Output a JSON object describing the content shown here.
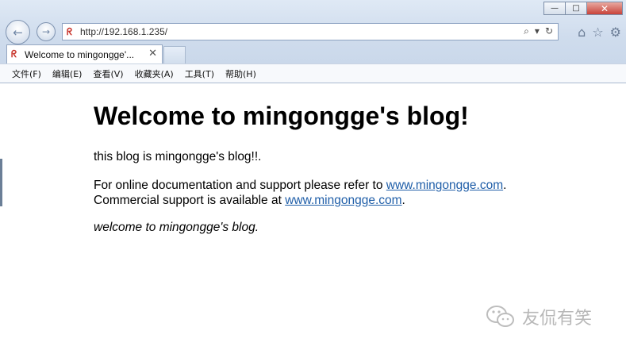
{
  "window": {
    "minimize_glyph": "—",
    "maximize_glyph": "□",
    "close_glyph": "✕"
  },
  "nav": {
    "back_glyph": "←",
    "forward_glyph": "→"
  },
  "address_bar": {
    "url": "http://192.168.1.235/",
    "search_glyph": "⌕",
    "dropdown_glyph": "▾",
    "refresh_glyph": "↻"
  },
  "toolbar_right": {
    "home_glyph": "⌂",
    "favorites_glyph": "☆",
    "settings_glyph": "⚙"
  },
  "tab": {
    "title": "Welcome to mingongge'...",
    "close_glyph": "✕"
  },
  "menubar": {
    "items": [
      "文件(F)",
      "编辑(E)",
      "查看(V)",
      "收藏夹(A)",
      "工具(T)",
      "帮助(H)"
    ]
  },
  "page": {
    "heading": "Welcome to mingongge's blog!",
    "intro": "this blog is mingongge's blog!!.",
    "doc_text_before": "For online documentation and support please refer to ",
    "doc_link": "www.mingongge.com",
    "doc_text_after": ".",
    "commercial_text_before": "Commercial support is available at ",
    "commercial_link": "www.mingongge.com",
    "commercial_text_after": ".",
    "closing": "welcome to mingongge's blog."
  },
  "watermark": {
    "text": "友侃有笑",
    "icon": "wechat-icon"
  }
}
